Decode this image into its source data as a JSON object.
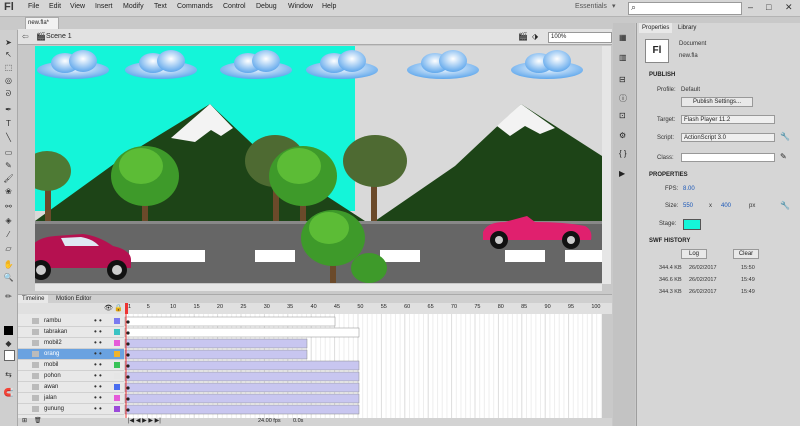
{
  "app": {
    "logo": "Fl",
    "workspace": "Essentials",
    "search_icon": "⌕"
  },
  "menu": [
    "File",
    "Edit",
    "View",
    "Insert",
    "Modify",
    "Text",
    "Commands",
    "Control",
    "Debug",
    "Window",
    "Help"
  ],
  "document": {
    "tab": "new.fla*",
    "scene": "Scene 1",
    "zoom": "100%"
  },
  "timeline": {
    "tabs": [
      "Timeline",
      "Motion Editor"
    ],
    "frame_numbers": [
      "1",
      "5",
      "10",
      "15",
      "20",
      "25",
      "30",
      "35",
      "40",
      "45",
      "50",
      "55",
      "60",
      "65",
      "70",
      "75",
      "80",
      "85",
      "90",
      "95",
      "100"
    ],
    "layers": [
      {
        "name": "rambu",
        "color": "#7a7af0",
        "span": 0.44
      },
      {
        "name": "tabrakan",
        "color": "#39c3c3",
        "span": 0.49
      },
      {
        "name": "mobil2",
        "color": "#e55ad9",
        "span": 0.38
      },
      {
        "name": "orang",
        "color": "#f0b42a",
        "span": 0.38
      },
      {
        "name": "mobil",
        "color": "#39c358",
        "span": 0.49
      },
      {
        "name": "pohon",
        "color": "#e6e6e6",
        "span": 0.49
      },
      {
        "name": "awan",
        "color": "#4a6ef0",
        "span": 0.49
      },
      {
        "name": "jalan",
        "color": "#e55ad9",
        "span": 0.49
      },
      {
        "name": "gunung",
        "color": "#9b4ad9",
        "span": 0.49
      }
    ],
    "footer": {
      "fps": "24.00 fps",
      "time": "0.0s"
    }
  },
  "properties": {
    "tabs": [
      "Properties",
      "Library"
    ],
    "doc_label": "Document",
    "doc_name": "new.fla",
    "publish": {
      "title": "PUBLISH",
      "profile_label": "Profile:",
      "profile": "Default",
      "settings_btn": "Publish Settings...",
      "target_label": "Target:",
      "target": "Flash Player 11.2",
      "script_label": "Script:",
      "script": "ActionScript 3.0",
      "class_label": "Class:"
    },
    "props": {
      "title": "PROPERTIES",
      "fps_label": "FPS:",
      "fps": "8.00",
      "size_label": "Size:",
      "width": "550",
      "height": "400",
      "unit": "px",
      "stage_label": "Stage:",
      "stage_color": "#14f5d9"
    },
    "swf": {
      "title": "SWF HISTORY",
      "log_btn": "Log",
      "clear_btn": "Clear",
      "rows": [
        {
          "size": "344.4 KB",
          "date": "26/02/2017",
          "time": "15:50"
        },
        {
          "size": "346.6 KB",
          "date": "26/02/2017",
          "time": "15:49"
        },
        {
          "size": "344.3 KB",
          "date": "26/02/2017",
          "time": "15:49"
        }
      ]
    }
  }
}
